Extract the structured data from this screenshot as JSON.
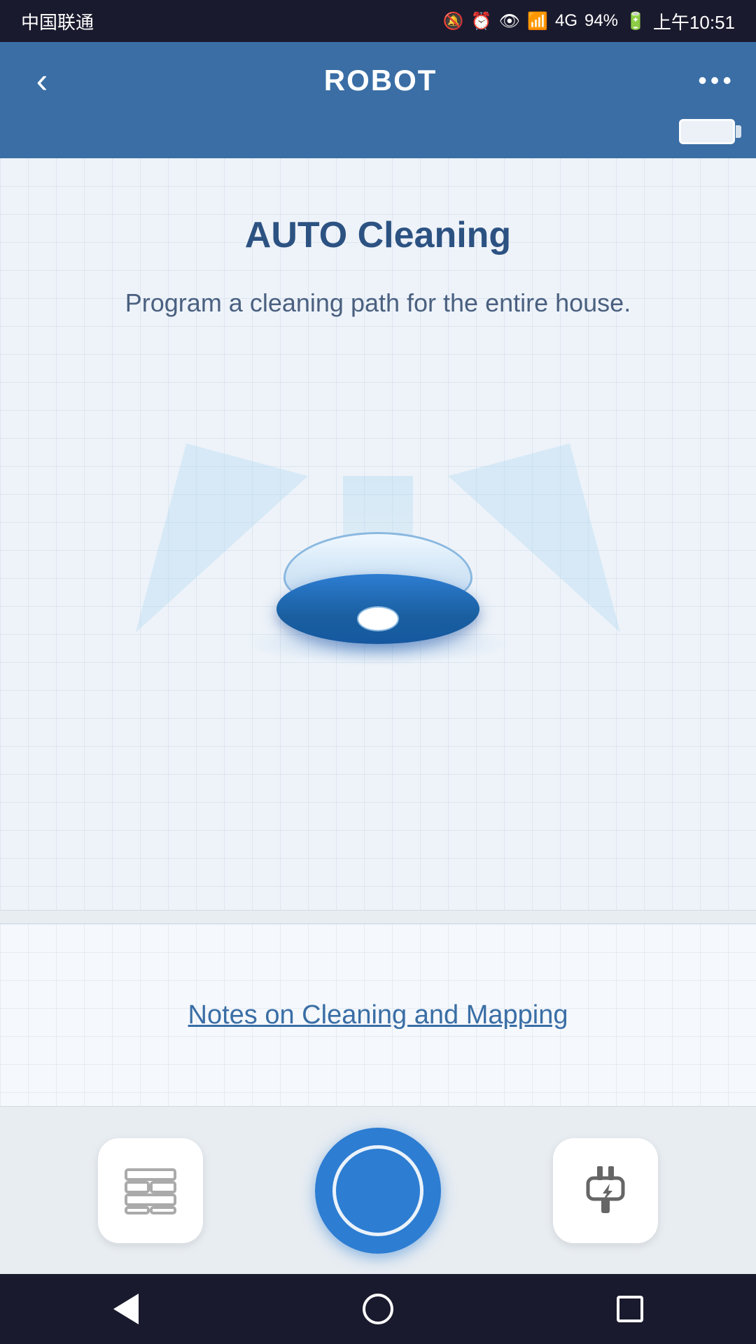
{
  "statusBar": {
    "carrier": "中国联通",
    "time": "上午10:51",
    "battery": "94%",
    "icons": "🔕 ⏰ 👁 📶"
  },
  "navBar": {
    "title": "ROBOT",
    "backLabel": "‹",
    "moreLabel": "•••"
  },
  "mainSection": {
    "autoCleaningTitle": "AUTO Cleaning",
    "autoCleaningDesc": "Program a cleaning path for the entire house."
  },
  "notesSection": {
    "notesLinkText": "Notes on Cleaning and Mapping"
  },
  "actionBar": {
    "mapButtonLabel": "map",
    "startButtonLabel": "start",
    "chargeButtonLabel": "charge"
  },
  "androidNav": {
    "backLabel": "back",
    "homeLabel": "home",
    "recentLabel": "recent"
  }
}
